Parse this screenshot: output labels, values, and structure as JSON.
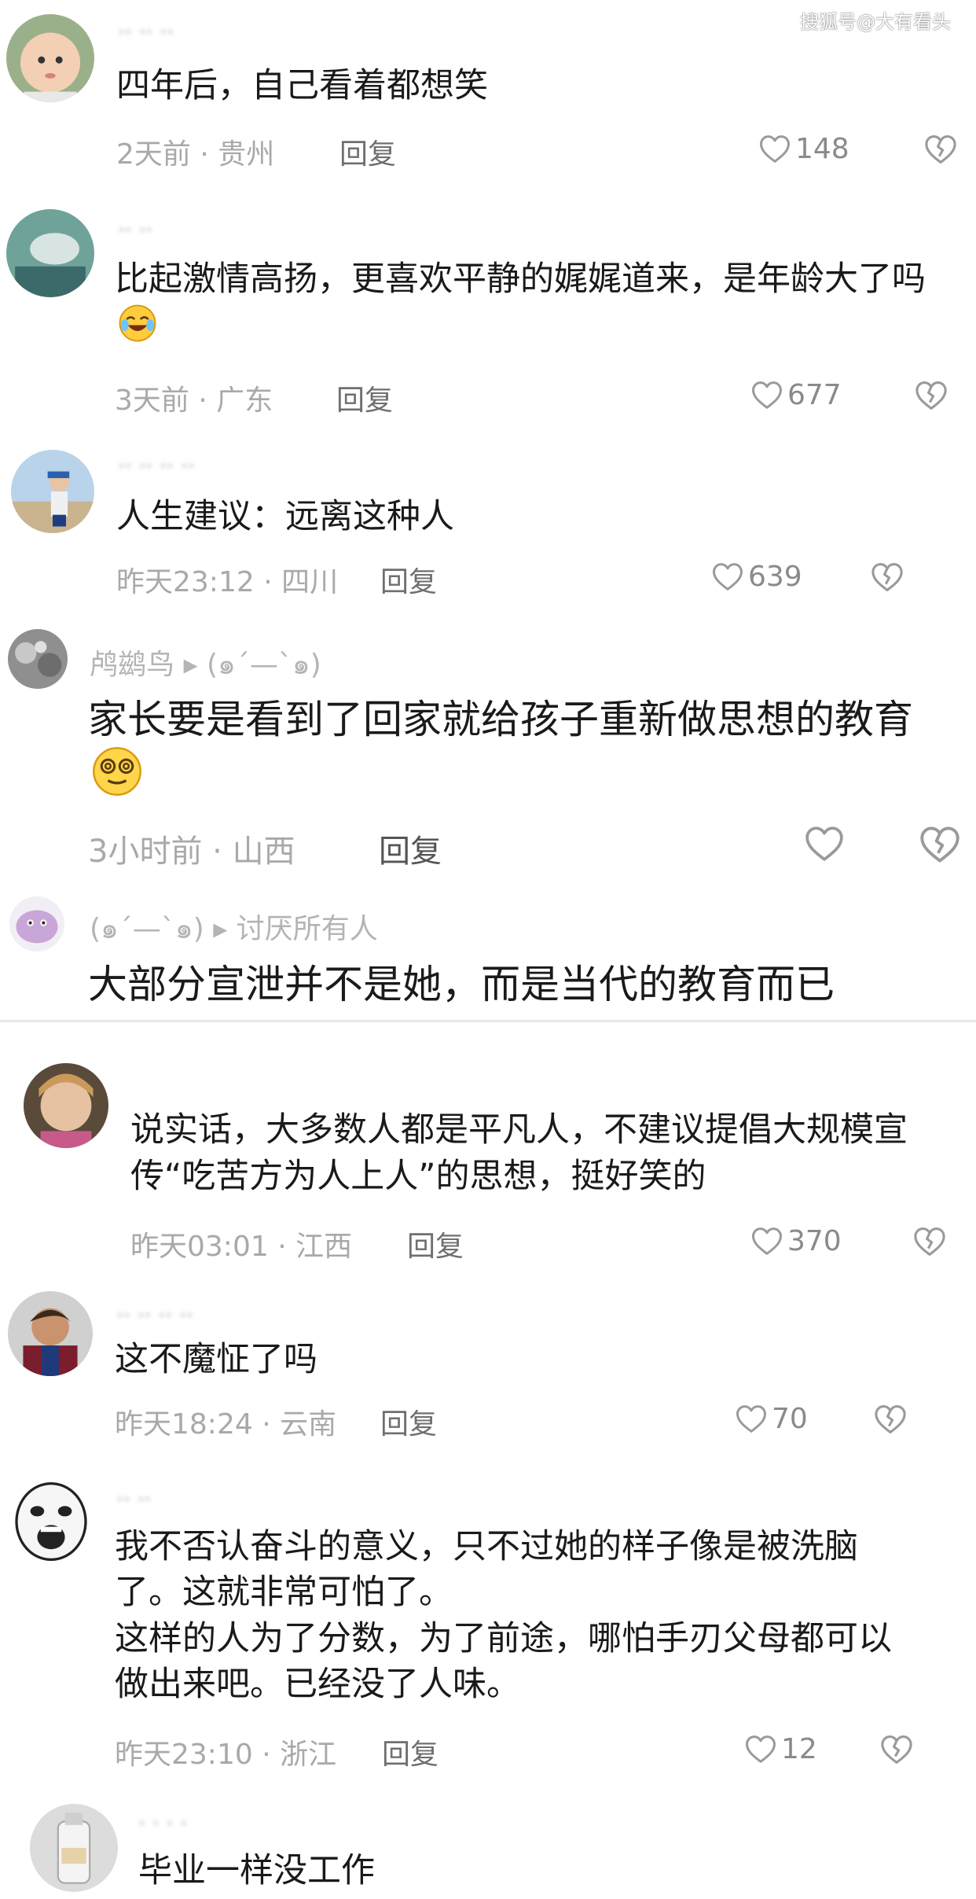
{
  "watermark": "搜狐号@大有看头",
  "comments": [
    {
      "username": "·· ·· ··",
      "text": "四年后，自己看着都想笑",
      "time_loc": "2天前 · 贵州",
      "reply": "回复",
      "likes": "148"
    },
    {
      "username": "·· ··",
      "text": "比起激情高扬，更喜欢平静的娓娓道来，是年龄大了吗",
      "time_loc": "3天前 · 广东",
      "reply": "回复",
      "likes": "677"
    },
    {
      "username": "·· ·· ·· ··",
      "text": "人生建议：远离这种人",
      "time_loc": "昨天23:12 · 四川",
      "reply": "回复",
      "likes": "639"
    },
    {
      "username": "鸬鹚鸟 ▸ (๑ˊ—ˋ๑)",
      "text": "家长要是看到了回家就给孩子重新做思想的教育",
      "time_loc": "3小时前 · 山西",
      "reply": "回复",
      "likes": ""
    },
    {
      "username": "(๑ˊ—ˋ๑) ▸ 讨厌所有人",
      "text": "大部分宣泄并不是她，而是当代的教育而已"
    },
    {
      "text": "说实话，大多数人都是平凡人，不建议提倡大规模宣传“吃苦方为人上人”的思想，挺好笑的",
      "time_loc": "昨天03:01 · 江西",
      "reply": "回复",
      "likes": "370"
    },
    {
      "username": "·· ·· ·· ··",
      "text": "这不魔怔了吗",
      "time_loc": "昨天18:24 · 云南",
      "reply": "回复",
      "likes": "70"
    },
    {
      "username": "·· ··",
      "text": "我不否认奋斗的意义，只不过她的样子像是被洗脑了。这就非常可怕了。\n这样的人为了分数，为了前途，哪怕手刃父母都可以做出来吧。已经没了人味。",
      "time_loc": "昨天23:10 · 浙江",
      "reply": "回复",
      "likes": "12"
    },
    {
      "username": "· · · ·",
      "text": "毕业一样没工作"
    }
  ]
}
